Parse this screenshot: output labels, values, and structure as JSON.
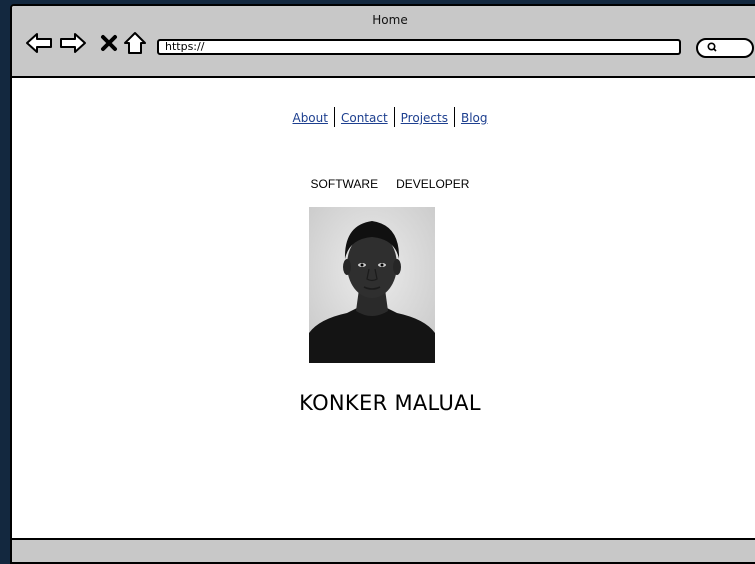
{
  "window": {
    "title": "Home"
  },
  "toolbar": {
    "back_icon": "arrow-left-icon",
    "forward_icon": "arrow-right-icon",
    "close_icon": "close-icon",
    "home_icon": "home-icon",
    "url": "https://",
    "search_icon": "search-icon"
  },
  "nav": {
    "items": [
      {
        "label": "About"
      },
      {
        "label": "Contact"
      },
      {
        "label": "Projects"
      },
      {
        "label": "Blog"
      }
    ]
  },
  "hero": {
    "subtitle_words": [
      "SOFTWARE",
      "DEVELOPER"
    ],
    "name": "KONKER MALUAL"
  },
  "colors": {
    "background": "#13283f",
    "chrome": "#c8c8c8",
    "link": "#1d3f8f"
  }
}
